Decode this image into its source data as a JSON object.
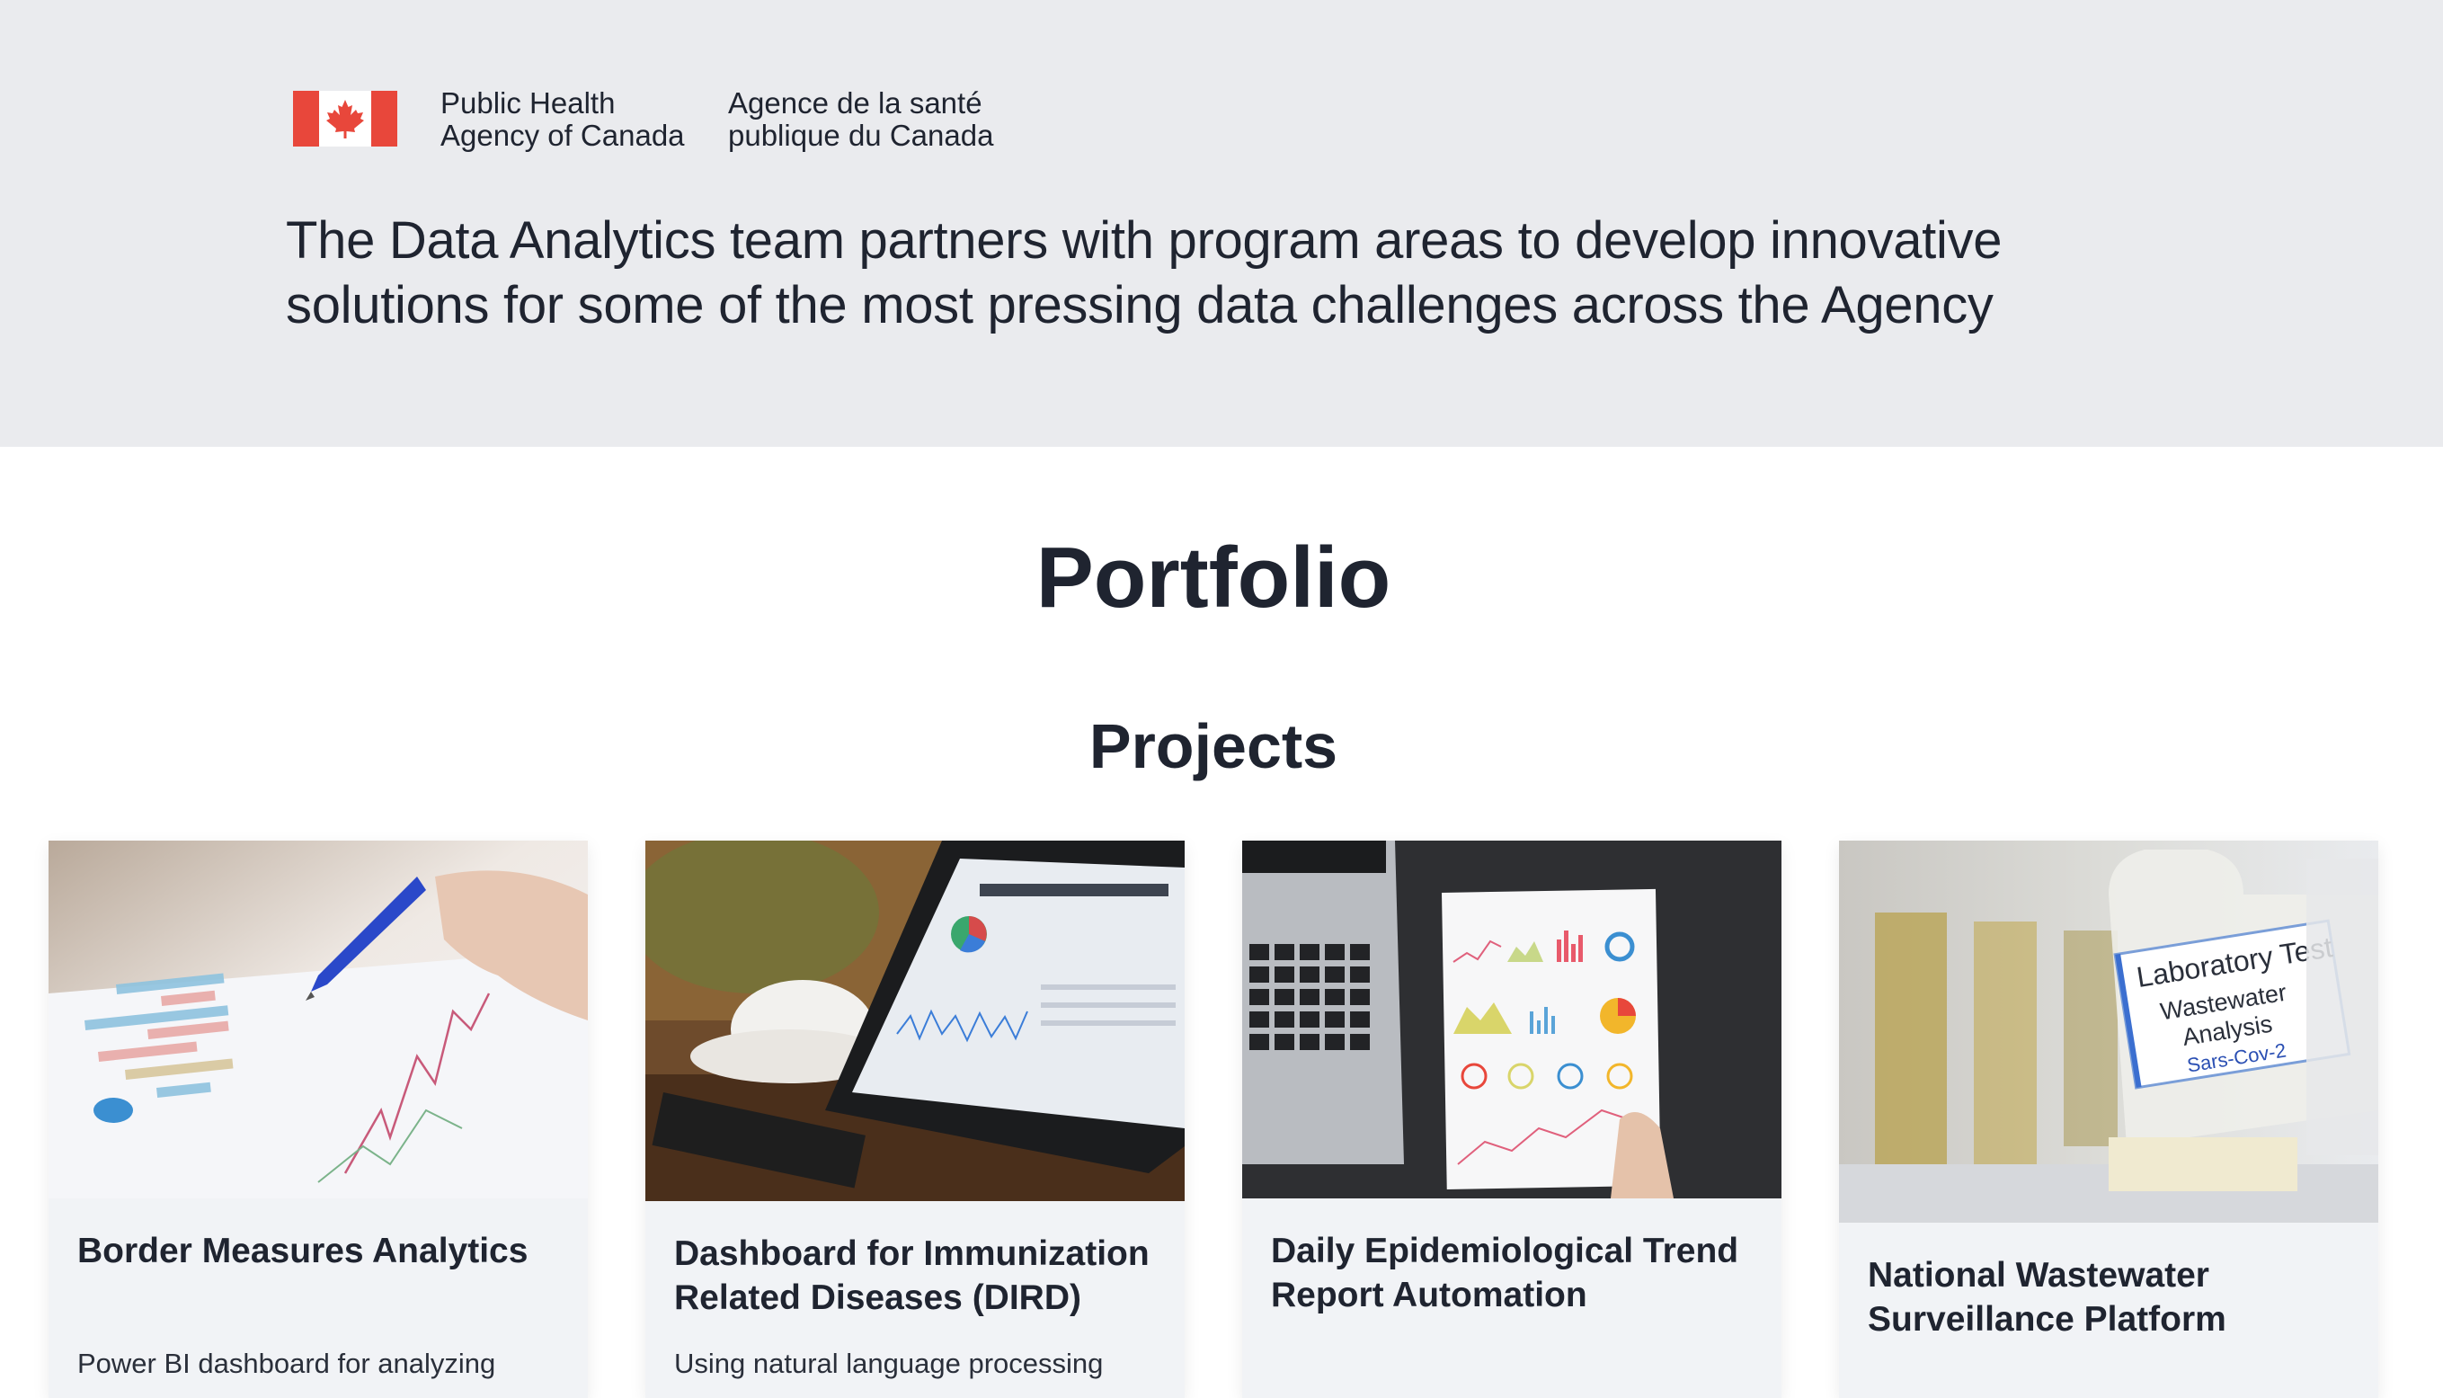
{
  "header": {
    "agency_en_line1": "Public Health",
    "agency_en_line2": "Agency of Canada",
    "agency_fr_line1": "Agence de la santé",
    "agency_fr_line2": "publique du Canada",
    "tagline_line1": "The Data Analytics team partners with program areas to develop innovative",
    "tagline_line2": "solutions for some of the most pressing data challenges across the Agency",
    "flag_colors": {
      "red": "#e8473b",
      "white": "#ffffff"
    }
  },
  "main": {
    "portfolio_title": "Portfolio",
    "projects_title": "Projects"
  },
  "projects": [
    {
      "title_line1": "Border Measures Analytics",
      "title_line2": "",
      "description": "Power BI dashboard for analyzing",
      "image": "document-charts-pen-photo"
    },
    {
      "title_line1": "Dashboard for Immunization",
      "title_line2": "Related Diseases (DIRD)",
      "description": "Using natural language processing",
      "image": "tablet-dashboard-coffee-photo"
    },
    {
      "title_line1": "Daily Epidemiological Trend",
      "title_line2": "Report Automation",
      "description": "",
      "image": "laptop-report-printout-photo"
    },
    {
      "title_line1": "National Wastewater",
      "title_line2": "Surveillance Platform",
      "description": "",
      "image": "wastewater-sample-bottle-photo",
      "bottle_label": {
        "line1": "Laboratory Test",
        "line2": "Wastewater",
        "line3": "Analysis",
        "line4": "Sars-Cov-2"
      }
    }
  ]
}
